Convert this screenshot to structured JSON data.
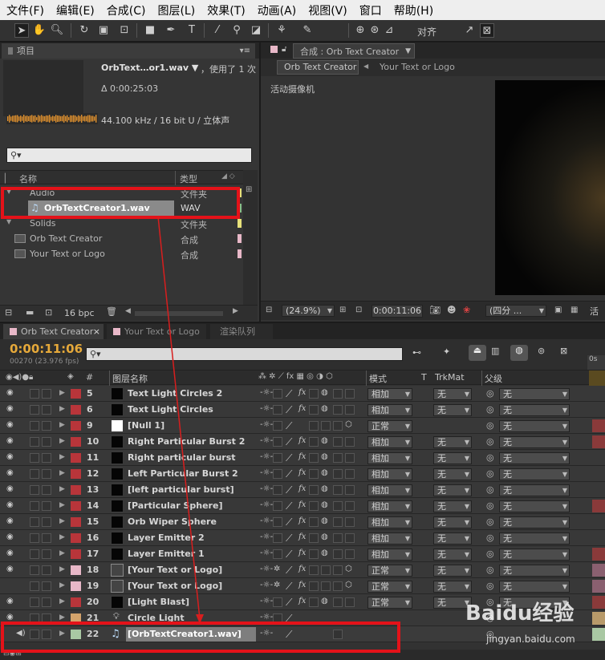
{
  "menu": [
    "文件(F)",
    "编辑(E)",
    "合成(C)",
    "图层(L)",
    "效果(T)",
    "动画(A)",
    "视图(V)",
    "窗口",
    "帮助(H)"
  ],
  "toolbar": {
    "align_label": "对齐"
  },
  "project": {
    "tab_label": "项目",
    "file_name": "OrbText…or1.wav ▼",
    "used_label": "，使用了 1 次",
    "duration": "Δ 0:00:25:03",
    "audio_info": "44.100 kHz / 16 bit U / 立体声",
    "search_placeholder": "",
    "col_name": "名称",
    "col_type": "类型",
    "items": [
      {
        "name": "Audio",
        "type": "文件夹",
        "color": "#e7e17a"
      },
      {
        "name": "OrbTextCreator1.wav",
        "type": "WAV",
        "color": "#87c08a"
      },
      {
        "name": "Solids",
        "type": "文件夹",
        "color": "#e7e17a"
      },
      {
        "name": "Orb Text Creator",
        "type": "合成",
        "color": "#e8b8c8"
      },
      {
        "name": "Your Text or Logo",
        "type": "合成",
        "color": "#e8b8c8"
      }
    ],
    "bpc": "16 bpc"
  },
  "composition": {
    "tab_label": "合成 : Orb Text Creator",
    "breadcrumb_1": "Orb Text Creator",
    "breadcrumb_2": "Your Text or Logo",
    "camera_label": "活动摄像机",
    "zoom": "(24.9%)",
    "timecode": "0:00:11:06",
    "resolution": "(四分 ...",
    "active_label": "活"
  },
  "timeline": {
    "tabs": [
      "Orb Text Creator",
      "Your Text or Logo",
      "渲染队列"
    ],
    "timecode": "0:00:11:06",
    "frame_info": "00270 (23.976 fps)",
    "header": {
      "num": "#",
      "layer_name": "图层名称",
      "mode": "模式",
      "t": "T",
      "trkmat": "TrkMat",
      "parent": "父级"
    },
    "layers": [
      {
        "num": "5",
        "name": "Text Light Circles 2",
        "color": "#b8353a",
        "mode": "相加",
        "trkmat": "无",
        "parent": "无"
      },
      {
        "num": "6",
        "name": "Text Light Circles",
        "color": "#b8353a",
        "mode": "相加",
        "trkmat": "无",
        "parent": "无"
      },
      {
        "num": "9",
        "name": "[Null 1]",
        "color": "#b8353a",
        "mode": "正常",
        "trkmat": "",
        "parent": "无"
      },
      {
        "num": "10",
        "name": "Right Particular Burst 2",
        "color": "#b8353a",
        "mode": "相加",
        "trkmat": "无",
        "parent": "无"
      },
      {
        "num": "11",
        "name": "Right particular burst",
        "color": "#b8353a",
        "mode": "相加",
        "trkmat": "无",
        "parent": "无"
      },
      {
        "num": "12",
        "name": "Left Particular Burst 2",
        "color": "#b8353a",
        "mode": "相加",
        "trkmat": "无",
        "parent": "无"
      },
      {
        "num": "13",
        "name": "[left particular burst]",
        "color": "#b8353a",
        "mode": "相加",
        "trkmat": "无",
        "parent": "无"
      },
      {
        "num": "14",
        "name": "[Particular Sphere]",
        "color": "#b8353a",
        "mode": "相加",
        "trkmat": "无",
        "parent": "无"
      },
      {
        "num": "15",
        "name": "Orb Wiper Sphere",
        "color": "#b8353a",
        "mode": "相加",
        "trkmat": "无",
        "parent": "无"
      },
      {
        "num": "16",
        "name": "Layer Emitter 2",
        "color": "#b8353a",
        "mode": "相加",
        "trkmat": "无",
        "parent": "无"
      },
      {
        "num": "17",
        "name": "Layer Emitter 1",
        "color": "#b8353a",
        "mode": "相加",
        "trkmat": "无",
        "parent": "无"
      },
      {
        "num": "18",
        "name": "[Your Text or Logo]",
        "color": "#e8b8c8",
        "mode": "正常",
        "trkmat": "无",
        "parent": "无"
      },
      {
        "num": "19",
        "name": "[Your Text or Logo]",
        "color": "#e8b8c8",
        "mode": "正常",
        "trkmat": "无",
        "parent": "无"
      },
      {
        "num": "20",
        "name": "[Light Blast]",
        "color": "#b8353a",
        "mode": "正常",
        "trkmat": "无",
        "parent": "无"
      },
      {
        "num": "21",
        "name": "Circle Light",
        "color": "#d4a36b",
        "mode": "",
        "trkmat": "",
        "parent": ""
      },
      {
        "num": "22",
        "name": "[OrbTextCreator1.wav]",
        "color": "#a9c8a3",
        "mode": "",
        "trkmat": "",
        "parent": ""
      }
    ]
  },
  "watermark": {
    "brand": "Baidu经验",
    "url": "jingyan.baidu.com"
  }
}
